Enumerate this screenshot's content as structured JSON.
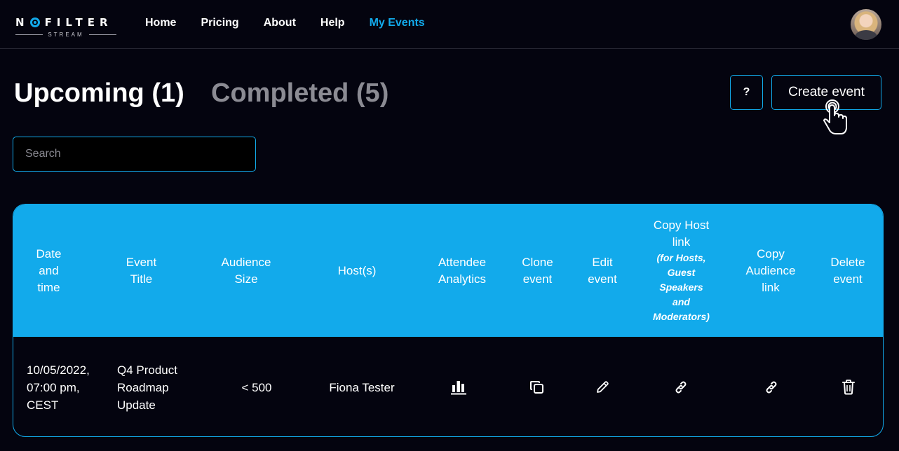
{
  "brand": {
    "logo_main": "N FILTER",
    "logo_sub": "STREAM"
  },
  "nav": {
    "items": [
      {
        "label": "Home",
        "active": false
      },
      {
        "label": "Pricing",
        "active": false
      },
      {
        "label": "About",
        "active": false
      },
      {
        "label": "Help",
        "active": false
      },
      {
        "label": "My Events",
        "active": true
      }
    ]
  },
  "tabs": {
    "upcoming": "Upcoming (1)",
    "completed": "Completed (5)"
  },
  "actions": {
    "help_label": "?",
    "create_label": "Create event"
  },
  "search": {
    "placeholder": "Search",
    "value": ""
  },
  "table": {
    "headers": {
      "date": "Date\nand\ntime",
      "title": "Event\nTitle",
      "audience": "Audience\nSize",
      "hosts": "Host(s)",
      "analytics": "Attendee\nAnalytics",
      "clone": "Clone\nevent",
      "edit": "Edit\nevent",
      "copy_host": "Copy Host\nlink",
      "copy_host_note": "(for Hosts,\nGuest\nSpeakers\nand\nModerators)",
      "copy_audience": "Copy\nAudience\nlink",
      "delete": "Delete\nevent"
    },
    "rows": [
      {
        "date": "10/05/2022,\n07:00 pm,\nCEST",
        "title": "Q4 Product\nRoadmap\nUpdate",
        "audience": "< 500",
        "hosts": "Fiona Tester",
        "icons": [
          "bar-chart-icon",
          "copy-icon",
          "pencil-icon",
          "link-icon",
          "link-icon",
          "trash-icon"
        ]
      }
    ]
  },
  "colors": {
    "accent": "#12aaeb",
    "background": "#04040f",
    "muted_tab": "#8b8b93"
  }
}
